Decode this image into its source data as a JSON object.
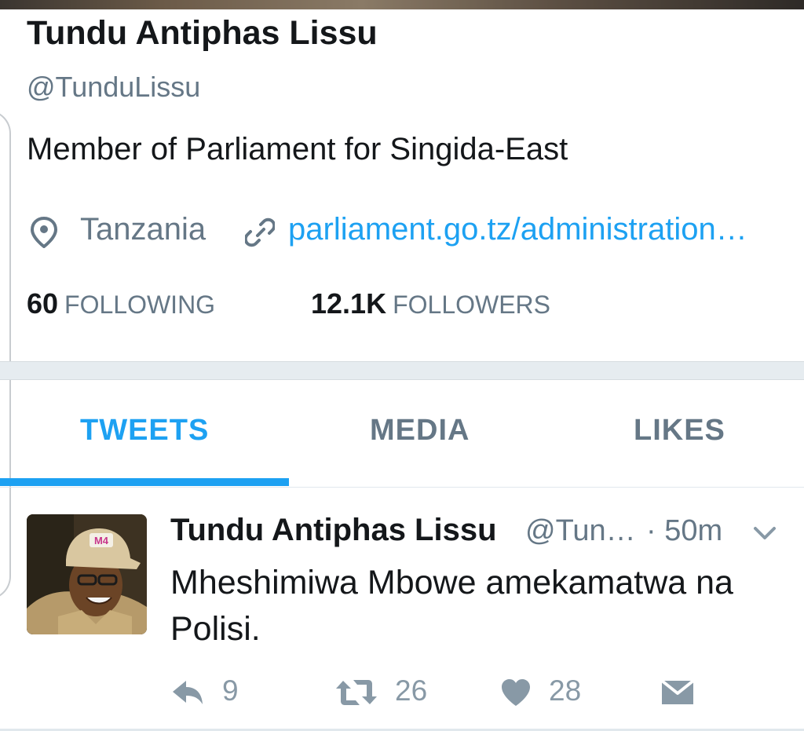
{
  "profile": {
    "name": "Tundu Antiphas Lissu",
    "handle": "@TunduLissu",
    "bio": "Member of Parliament for Singida-East",
    "location": "Tanzania",
    "website": "parliament.go.tz/administration…",
    "following_count": "60",
    "following_label": "FOLLOWING",
    "followers_count": "12.1K",
    "followers_label": "FOLLOWERS"
  },
  "tabs": [
    {
      "label": "TWEETS",
      "active": true
    },
    {
      "label": "MEDIA",
      "active": false
    },
    {
      "label": "LIKES",
      "active": false
    }
  ],
  "tweet": {
    "name": "Tundu Antiphas Lissu",
    "handle": "@Tun…",
    "time": "· 50m",
    "text": "Mheshimiwa Mbowe amekamatwa na Polisi.",
    "avatar_cap_text": "M4",
    "reply_count": "9",
    "retweet_count": "26",
    "like_count": "28"
  },
  "colors": {
    "accent": "#1da1f2",
    "text": "#14171a",
    "muted": "#657786",
    "icon": "#8899a6",
    "separator": "#e6ecf0"
  },
  "icons": {
    "location": "map-pin-icon",
    "link": "link-icon",
    "menu": "chevron-down-icon",
    "reply": "reply-icon",
    "retweet": "retweet-icon",
    "like": "heart-icon",
    "message": "envelope-icon"
  }
}
